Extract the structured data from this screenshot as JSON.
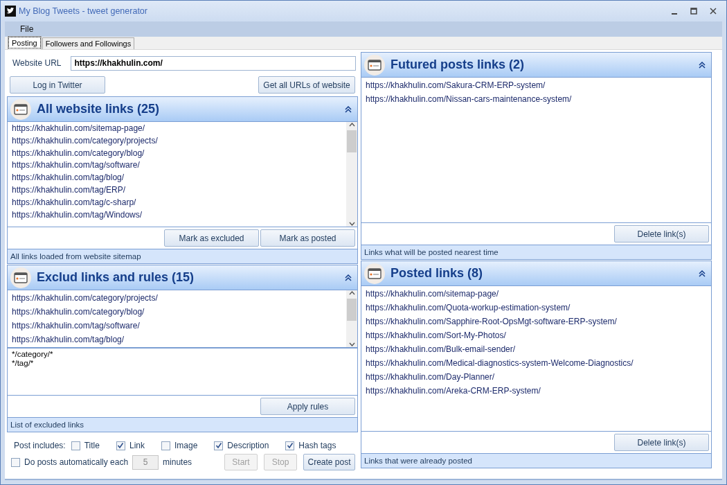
{
  "window": {
    "title": "My Blog Tweets - tweet generator"
  },
  "menu": [
    "File"
  ],
  "tabs": [
    {
      "label": "Posting",
      "selected": true
    },
    {
      "label": "Followers and Followings",
      "selected": false
    }
  ],
  "website_url": {
    "label": "Website URL",
    "value": "https://khakhulin.com/"
  },
  "top_buttons": [
    {
      "label": "Log in Twitter"
    },
    {
      "label": "Get all URLs of website"
    }
  ],
  "panels": [
    {
      "title": "All website links (25)",
      "links": [
        "https://khakhulin.com/sitemap-page/",
        "https://khakhulin.com/category/projects/",
        "https://khakhulin.com/category/blog/",
        "https://khakhulin.com/tag/software/",
        "https://khakhulin.com/tag/blog/",
        "https://khakhulin.com/tag/ERP/",
        "https://khakhulin.com/tag/c-sharp/",
        "https://khakhulin.com/tag/Windows/"
      ],
      "buttons": [
        "Mark as excluded",
        "Mark as posted"
      ],
      "footer": "All links loaded from website sitemap"
    },
    {
      "title": "Exclud links and rules (15)",
      "links": [
        "https://khakhulin.com/category/projects/",
        "https://khakhulin.com/category/blog/",
        "https://khakhulin.com/tag/software/",
        "https://khakhulin.com/tag/blog/"
      ],
      "rules": "*/category/*\n*/tag/*",
      "buttons": [
        "Apply rules"
      ],
      "footer": "List of excluded links"
    },
    {
      "title": "Futured posts links (2)",
      "links": [
        "https://khakhulin.com/Sakura-CRM-ERP-system/",
        "https://khakhulin.com/Nissan-cars-maintenance-system/"
      ],
      "buttons": [
        "Delete link(s)"
      ],
      "footer": "Links what will be posted nearest time"
    },
    {
      "title": "Posted links (8)",
      "links": [
        "https://khakhulin.com/sitemap-page/",
        "https://khakhulin.com/Quota-workup-estimation-system/",
        "https://khakhulin.com/Sapphire-Root-OpsMgt-software-ERP-system/",
        "https://khakhulin.com/Sort-My-Photos/",
        "https://khakhulin.com/Bulk-email-sender/",
        "https://khakhulin.com/Medical-diagnostics-system-Welcome-Diagnostics/",
        "https://khakhulin.com/Day-Planner/",
        "https://khakhulin.com/Areka-CRM-ERP-system/"
      ],
      "buttons": [
        "Delete link(s)"
      ],
      "footer": "Links that were already posted"
    }
  ],
  "post_includes": {
    "label": "Post includes:",
    "options": [
      {
        "label": "Title",
        "checked": false
      },
      {
        "label": "Link",
        "checked": true
      },
      {
        "label": "Image",
        "checked": false
      },
      {
        "label": "Description",
        "checked": true
      },
      {
        "label": "Hash tags",
        "checked": true
      }
    ]
  },
  "auto_post": {
    "label": "Do posts automatically each",
    "checked": false,
    "interval": "5",
    "interval_disabled": true,
    "unit": "minutes"
  },
  "action_buttons": [
    {
      "label": "Start",
      "disabled": true
    },
    {
      "label": "Stop",
      "disabled": true
    },
    {
      "label": "Create post",
      "disabled": false
    }
  ]
}
